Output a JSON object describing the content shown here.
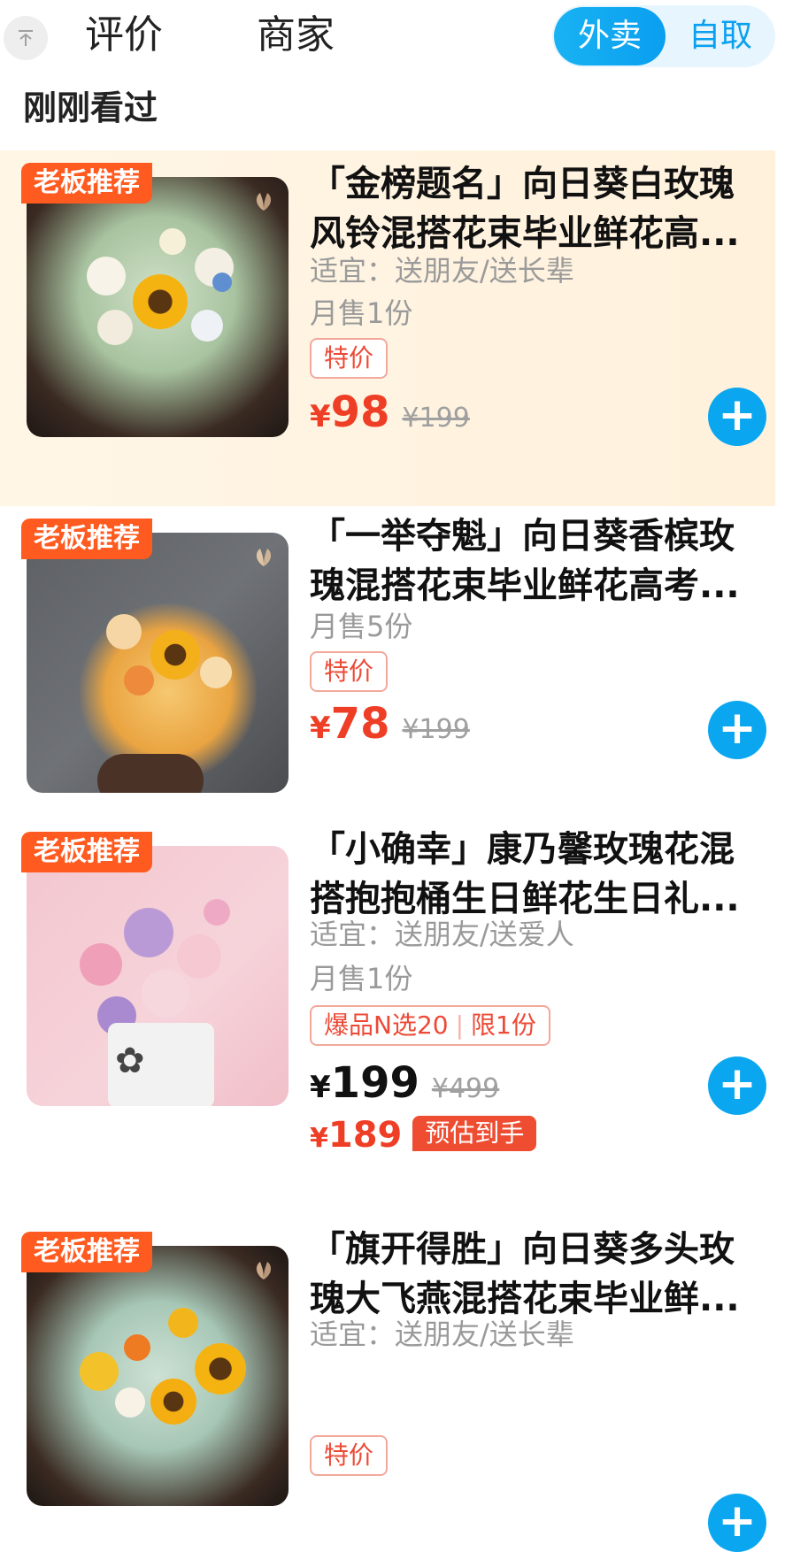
{
  "topbar": {
    "tabs": [
      {
        "label": "评价"
      },
      {
        "label": "商家"
      }
    ],
    "mode": {
      "delivery": "外卖",
      "pickup": "自取"
    }
  },
  "section_title": "刚刚看过",
  "products": [
    {
      "badge": "老板推荐",
      "title_line1": "「金榜题名」向日葵白玫瑰",
      "title_line2": "风铃混搭花束毕业鲜花高...",
      "suitable": "适宜：送朋友/送长辈",
      "monthly_sales": "月售1份",
      "tag": "特价",
      "price_currency": "¥",
      "price": "98",
      "original_price": "¥199"
    },
    {
      "badge": "老板推荐",
      "title_line1": "「一举夺魁」向日葵香槟玫",
      "title_line2": "瑰混搭花束毕业鲜花高考...",
      "monthly_sales": "月售5份",
      "tag": "特价",
      "price_currency": "¥",
      "price": "78",
      "original_price": "¥199"
    },
    {
      "badge": "老板推荐",
      "title_line1": "「小确幸」康乃馨玫瑰花混",
      "title_line2": "搭抱抱桶生日鲜花生日礼...",
      "suitable": "适宜：送朋友/送爱人",
      "monthly_sales": "月售1份",
      "tag_part1": "爆品N选20",
      "tag_part2": "限1份",
      "price_currency": "¥",
      "price": "199",
      "original_price": "¥499",
      "est_currency": "¥",
      "est_price": "189",
      "est_label": "预估到手"
    },
    {
      "badge": "老板推荐",
      "title_line1": "「旗开得胜」向日葵多头玫",
      "title_line2": "瑰大飞燕混搭花束毕业鲜...",
      "suitable": "适宜：送朋友/送长辈",
      "tag": "特价"
    }
  ],
  "colors": {
    "accent_blue": "#0aa7f0",
    "price_red": "#ef3e26",
    "badge_orange": "#ff5a1f",
    "highlight_bg": "#fff3e0"
  },
  "icons": {
    "scroll_top": "arrow-up-to-top-icon",
    "add": "plus-circle-icon"
  }
}
